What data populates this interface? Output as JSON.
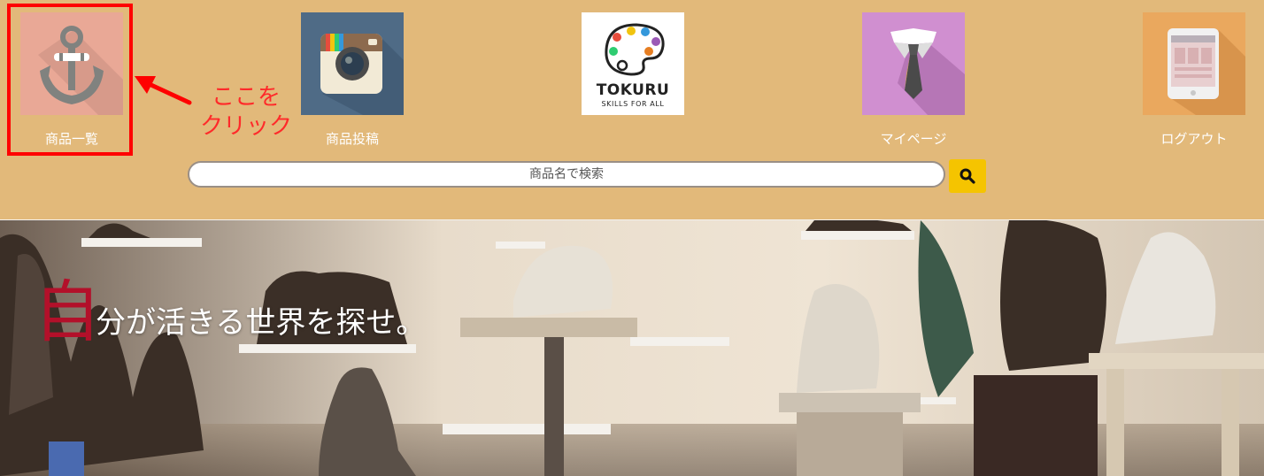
{
  "nav": {
    "items": [
      {
        "key": "products",
        "label": "商品一覧",
        "icon": "anchor-icon"
      },
      {
        "key": "post",
        "label": "商品投稿",
        "icon": "camera-icon"
      },
      {
        "key": "logo",
        "brand": "TOKURU",
        "tagline": "SKILLS FOR ALL",
        "icon": "palette-icon"
      },
      {
        "key": "mypage",
        "label": "マイページ",
        "icon": "tie-icon"
      },
      {
        "key": "logout",
        "label": "ログアウト",
        "icon": "tablet-icon"
      }
    ]
  },
  "search": {
    "placeholder": "商品名で検索",
    "button_icon": "search-icon",
    "button_color": "#f5c400"
  },
  "hero": {
    "first_char": "自",
    "rest": "分が活きる世界を探せ。",
    "accent_color": "#b3102a"
  },
  "annotation": {
    "line1": "ここを",
    "line2": "クリック",
    "color": "#ff2a2a"
  },
  "colors": {
    "header_bg": "#e2b97a"
  }
}
